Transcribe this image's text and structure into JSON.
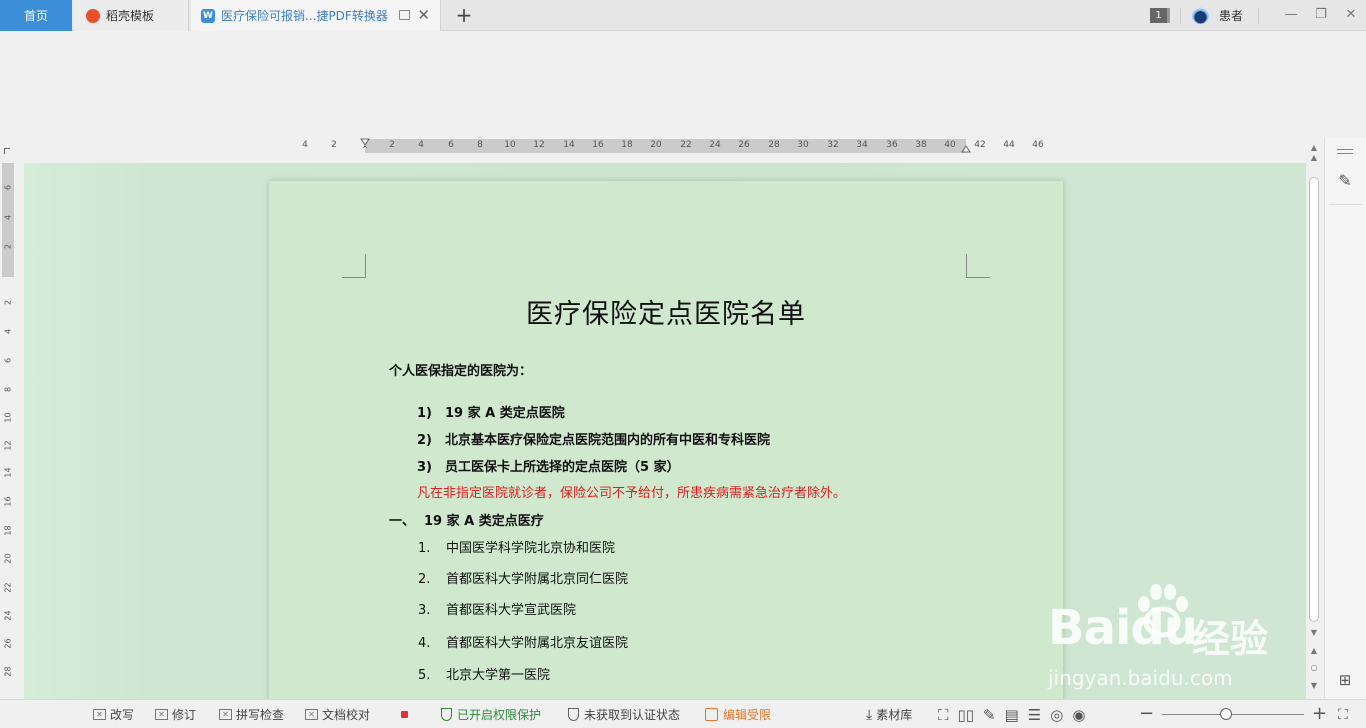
{
  "tabs": {
    "home": "首页",
    "templates": "稻壳模板",
    "document": "医疗保险可报销...捷PDF转换器",
    "document_icon_letter": "W",
    "new_tab": "+"
  },
  "titlebar": {
    "window_count": "1",
    "user_name": "患者"
  },
  "ruler": {
    "horizontal_ticks": [
      "4",
      "2",
      "2",
      "4",
      "6",
      "8",
      "10",
      "12",
      "14",
      "16",
      "18",
      "20",
      "22",
      "24",
      "26",
      "28",
      "30",
      "32",
      "34",
      "36",
      "38",
      "40",
      "42",
      "44",
      "46"
    ],
    "vertical_ticks": [
      "6",
      "4",
      "2",
      "2",
      "4",
      "6",
      "8",
      "10",
      "12",
      "14",
      "16",
      "18",
      "20",
      "22",
      "24",
      "26",
      "28"
    ]
  },
  "document": {
    "title": "医疗保险定点医院名单",
    "intro": "个人医保指定的医院为：",
    "bold_items": [
      {
        "num": "1)",
        "text": "19 家 A 类定点医院"
      },
      {
        "num": "2)",
        "text": "北京基本医疗保险定点医院范围内的所有中医和专科医院"
      },
      {
        "num": "3)",
        "text": "员工医保卡上所选择的定点医院（5 家）"
      }
    ],
    "note": "凡在非指定医院就诊者，保险公司不予给付，所患疾病需紧急治疗者除外。",
    "section_index": "一、",
    "section_title": "19 家 A 类定点医疗",
    "hospitals": [
      {
        "num": "1.",
        "name": "中国医学科学院北京协和医院"
      },
      {
        "num": "2.",
        "name": "首都医科大学附属北京同仁医院"
      },
      {
        "num": "3.",
        "name": "首都医科大学宣武医院"
      },
      {
        "num": "4.",
        "name": "首都医科大学附属北京友谊医院"
      },
      {
        "num": "5.",
        "name": "北京大学第一医院"
      }
    ]
  },
  "statusbar": {
    "rewrite": "改写",
    "revise": "修订",
    "spellcheck": "拼写检查",
    "proofread": "文档校对",
    "permission": "已开启权限保护",
    "cert": "未获取到认证状态",
    "edit_restricted": "编辑受限",
    "library": "素材库",
    "zoom_minus": "−",
    "zoom_plus": "+",
    "zoom_level_fraction": 0.45
  },
  "watermark": {
    "logo": "Baidu",
    "cn": "经验",
    "url": "jingyan.baidu.com"
  },
  "colors": {
    "accent": "#3d8ed8",
    "page_bg": "#cfe8ce",
    "warning_text": "#e02020",
    "protected_green": "#2e8b3a",
    "restricted_orange": "#e0762a"
  }
}
